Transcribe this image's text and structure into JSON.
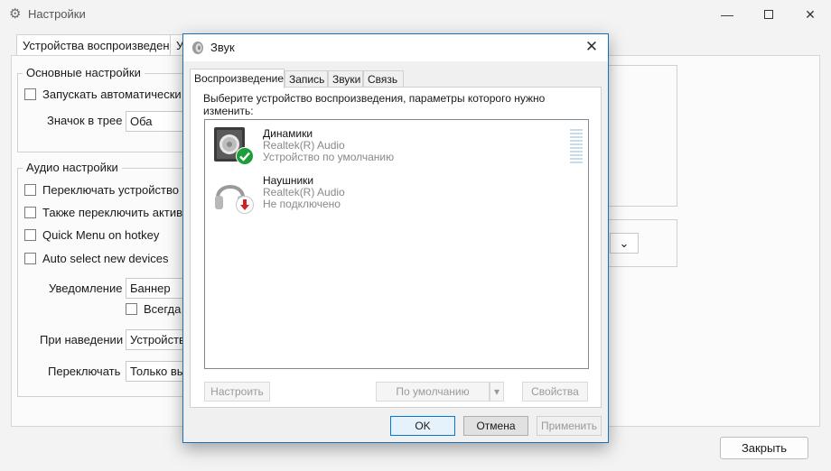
{
  "settings_window": {
    "title": "Настройки",
    "tabs": [
      "Устройства воспроизведения",
      "У"
    ],
    "basic_group": {
      "title": "Основные настройки",
      "autostart_label": "Запускать автоматически с W",
      "tray_icon_label": "Значок в трее",
      "tray_icon_value": "Оба"
    },
    "audio_group": {
      "title": "Аудио настройки",
      "options": [
        "Переключать устройство св",
        "Также переключить активну",
        "Quick Menu on hotkey",
        "Auto select new devices"
      ],
      "notification_label": "Уведомление",
      "notification_value": "Баннер",
      "always_label": "Всегда и",
      "hover_label": "При наведении",
      "hover_value": "Устройство",
      "switch_label": "Переключать",
      "switch_value": "Только выб"
    },
    "close_button": "Закрыть",
    "icons": {
      "app": "gear-icon",
      "minimize": "minimize-icon",
      "maximize": "maximize-icon",
      "close": "close-icon"
    }
  },
  "sound_dialog": {
    "title": "Звук",
    "tabs": [
      "Воспроизведение",
      "Запись",
      "Звуки",
      "Связь"
    ],
    "active_tab": 0,
    "instruction": "Выберите устройство воспроизведения, параметры которого нужно изменить:",
    "devices": [
      {
        "name": "Динамики",
        "driver": "Realtek(R) Audio",
        "status": "Устройство по умолчанию",
        "icon": "speaker-icon",
        "badge": "default-check-icon"
      },
      {
        "name": "Наушники",
        "driver": "Realtek(R) Audio",
        "status": "Не подключено",
        "icon": "headphones-icon",
        "badge": "disconnected-arrow-icon"
      }
    ],
    "panel_buttons": {
      "configure": "Настроить",
      "set_default": "По умолчанию",
      "properties": "Свойства"
    },
    "buttons": {
      "ok": "OK",
      "cancel": "Отмена",
      "apply": "Применить"
    },
    "colors": {
      "accent": "#0078d7",
      "check": "#1e9e3a",
      "arrow": "#d42020"
    }
  }
}
